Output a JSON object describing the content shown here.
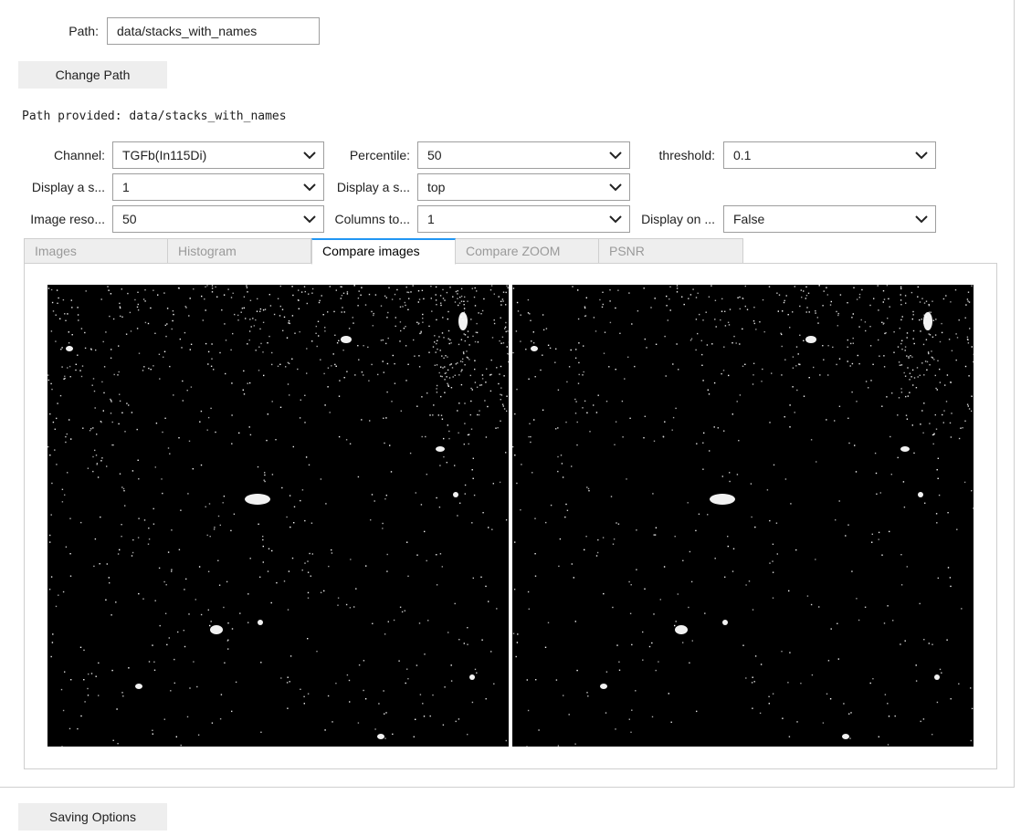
{
  "path_field": {
    "label": "Path:",
    "value": "data/stacks_with_names"
  },
  "change_path_button": "Change Path",
  "path_message": "Path provided: data/stacks_with_names",
  "controls": {
    "channel": {
      "label": "Channel:",
      "value": "TGFb(In115Di)"
    },
    "percentile": {
      "label": "Percentile:",
      "value": "50"
    },
    "threshold": {
      "label": "threshold:",
      "value": "0.1"
    },
    "display_a_s_1": {
      "label": "Display a s...",
      "value": "1"
    },
    "display_a_s_2": {
      "label": "Display a s...",
      "value": "top"
    },
    "image_reso": {
      "label": "Image reso...",
      "value": "50"
    },
    "columns_to": {
      "label": "Columns to...",
      "value": "1"
    },
    "display_on": {
      "label": "Display on ...",
      "value": "False"
    }
  },
  "tabs": [
    {
      "label": "Images",
      "active": false
    },
    {
      "label": "Histogram",
      "active": false
    },
    {
      "label": "Compare images",
      "active": true
    },
    {
      "label": "Compare ZOOM",
      "active": false
    },
    {
      "label": "PSNR",
      "active": false
    }
  ],
  "saving_options_button": "Saving Options",
  "colors": {
    "active_tab_accent": "#2196f3",
    "button_bg": "#eeeeee",
    "border": "#9e9e9e"
  },
  "icons": {
    "dropdown": "chevron-down-icon"
  }
}
